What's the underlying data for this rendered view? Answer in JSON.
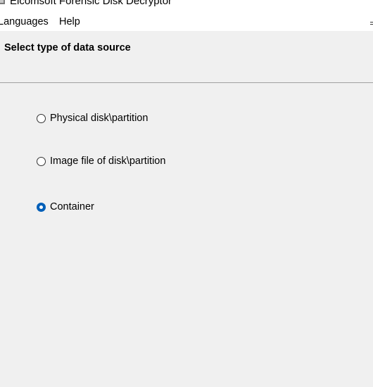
{
  "window": {
    "title": "Elcomsoft Forensic Disk Decryptor"
  },
  "menu": {
    "items": [
      "Languages",
      "Help"
    ]
  },
  "page": {
    "title": "Select type of data source"
  },
  "source_options": [
    {
      "label": "Physical disk\\partition",
      "selected": false
    },
    {
      "label": "Image file of disk\\partition",
      "selected": false
    },
    {
      "label": "Container",
      "selected": true
    }
  ],
  "colors": {
    "radio_selected": "#005fb8",
    "panel_background": "#f0f0f0",
    "separator": "#a0a0a0"
  }
}
